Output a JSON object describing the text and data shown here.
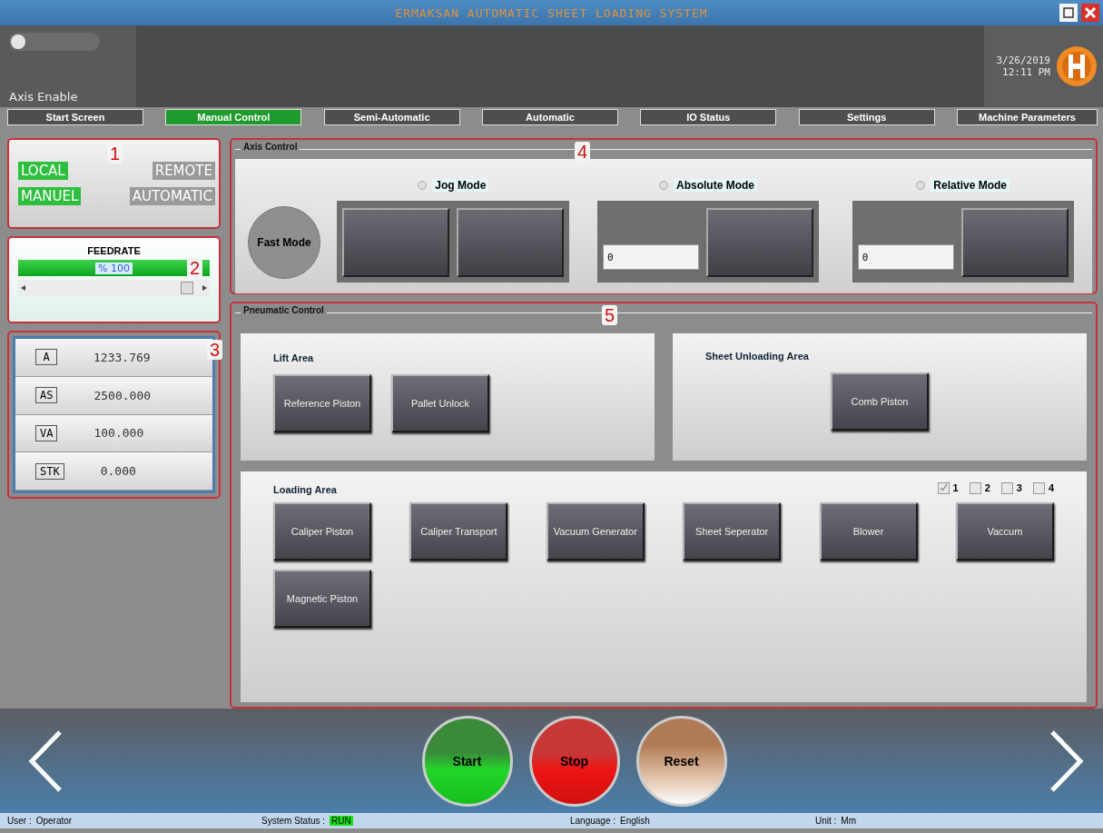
{
  "window": {
    "title": "ERMAKSAN AUTOMATIC SHEET LOADING SYSTEM"
  },
  "header": {
    "axis_enable": {
      "label": "Axis Enable",
      "on": false
    },
    "date": "3/26/2019",
    "time": "12:11 PM"
  },
  "tabs": [
    {
      "label": "Start Screen",
      "selected": false
    },
    {
      "label": "Manual Control",
      "selected": true
    },
    {
      "label": "Semi-Automatic",
      "selected": false
    },
    {
      "label": "Automatic",
      "selected": false
    },
    {
      "label": "IO Status",
      "selected": false
    },
    {
      "label": "Settings",
      "selected": false
    },
    {
      "label": "Machine Parameters",
      "selected": false
    }
  ],
  "mode_panel": {
    "annotation": "1",
    "indicators": [
      {
        "label": "LOCAL",
        "on": true
      },
      {
        "label": "REMOTE",
        "on": false
      },
      {
        "label": "MANUEL",
        "on": true
      },
      {
        "label": "AUTOMATIC",
        "on": false
      }
    ]
  },
  "feedrate": {
    "annotation": "2",
    "title": "FEEDRATE",
    "value": "% 100",
    "level": 1,
    "slider": {
      "level": 0.88
    }
  },
  "axes": {
    "annotation": "3",
    "rows": [
      {
        "name": "A",
        "value": "1233.769"
      },
      {
        "name": "AS",
        "value": "2500.000"
      },
      {
        "name": "VA",
        "value": "100.000"
      },
      {
        "name": "STK",
        "value": "0.000"
      }
    ]
  },
  "axis_control": {
    "title": "Axis Control",
    "annotation": "4",
    "fast_mode": "Fast Mode",
    "modes": [
      {
        "label": "Jog Mode",
        "selected": false,
        "kind": "jog"
      },
      {
        "label": "Absolute Mode",
        "selected": false,
        "kind": "position",
        "field_value": "0"
      },
      {
        "label": "Relative Mode",
        "selected": false,
        "kind": "position",
        "field_value": "0"
      }
    ]
  },
  "pneumatic_control": {
    "title": "Pneumatic Control",
    "annotation": "5",
    "lift_area": {
      "title": "Lift Area",
      "buttons": [
        "Reference Piston",
        "Pallet Unlock"
      ]
    },
    "sheet_unloading_area": {
      "title": "Sheet Unloading Area",
      "buttons": [
        "Comb Piston"
      ]
    },
    "loading_area": {
      "title": "Loading Area",
      "checkboxes": [
        {
          "label": "1",
          "checked": true
        },
        {
          "label": "2",
          "checked": false
        },
        {
          "label": "3",
          "checked": false
        },
        {
          "label": "4",
          "checked": false
        }
      ],
      "buttons": [
        "Caliper Piston",
        "Caliper Transport",
        "Vacuum Generator",
        "Sheet Seperator",
        "Blower",
        "Vaccum",
        "Magnetic Piston"
      ]
    }
  },
  "cycle_buttons": [
    {
      "label": "Start",
      "kind": "start"
    },
    {
      "label": "Stop",
      "kind": "stop"
    },
    {
      "label": "Reset",
      "kind": "reset"
    }
  ],
  "status_bar": [
    {
      "label": "User :",
      "value": "Operator",
      "highlighted": false
    },
    {
      "label": "System Status :",
      "value": "RUN",
      "highlighted": true
    },
    {
      "label": "Language :",
      "value": "English",
      "highlighted": false
    },
    {
      "label": "Unit :",
      "value": "Mm",
      "highlighted": false
    }
  ]
}
